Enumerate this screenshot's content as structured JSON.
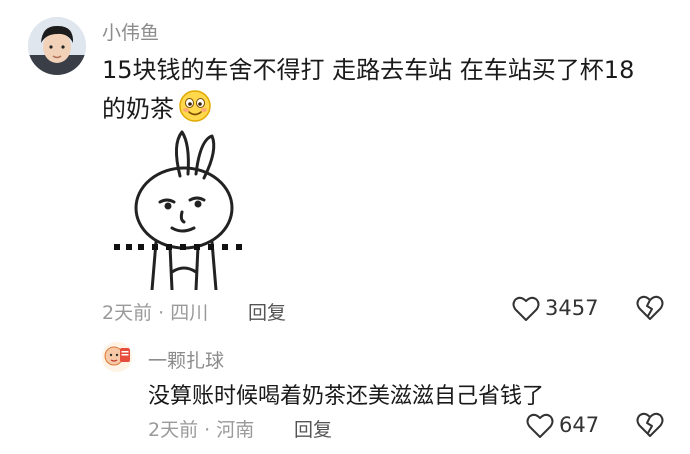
{
  "comment": {
    "username": "小伟鱼",
    "text_line1": "15块钱的车舍不得打 走路去车站 在车站买了杯18",
    "text_line2": "的奶茶",
    "emoji": "smiling-face-emoji",
    "sticker": "bunny-sticker",
    "time_location": "2天前 · 四川",
    "reply_label": "回复",
    "likes": "3457"
  },
  "reply": {
    "username": "一颗扎球",
    "text": "没算账时候喝着奶茶还美滋滋自己省钱了",
    "time_location": "2天前 · 河南",
    "reply_label": "回复",
    "likes": "647"
  },
  "colors": {
    "secondary_text": "#9a9a9a",
    "username": "#8c8c8c",
    "primary_text": "#1a1a1a"
  }
}
